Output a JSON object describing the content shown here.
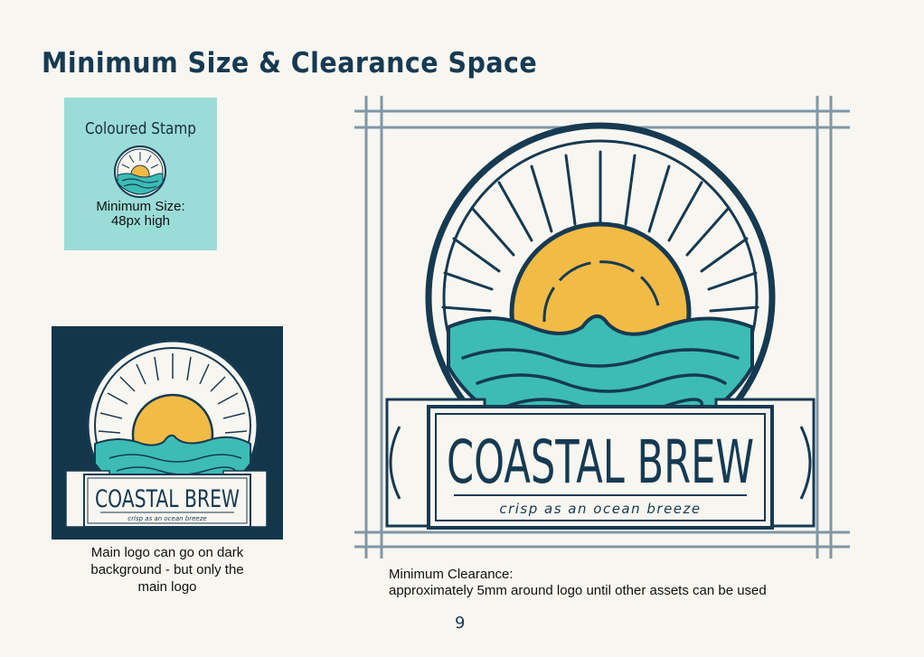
{
  "page": {
    "title": "Minimum Size & Clearance Space",
    "page_number": "9"
  },
  "stamp": {
    "heading": "Coloured Stamp",
    "min_size_line1": "Minimum Size:",
    "min_size_line2": "48px high",
    "background_color": "#9adcd8"
  },
  "dark_example": {
    "caption_line1": "Main logo can go on dark",
    "caption_line2": "background - but only the",
    "caption_line3": "main logo",
    "background_color": "#14364b"
  },
  "clearance": {
    "caption_line1": "Minimum Clearance:",
    "caption_line2": "approximately 5mm around logo until other assets can be used"
  },
  "logo": {
    "name": "COASTAL BREW",
    "tagline": "crisp as an ocean breeze",
    "colors": {
      "navy": "#163a52",
      "sun": "#f2bb45",
      "sea": "#3cbcb4",
      "cream": "#f8f6f0"
    }
  }
}
